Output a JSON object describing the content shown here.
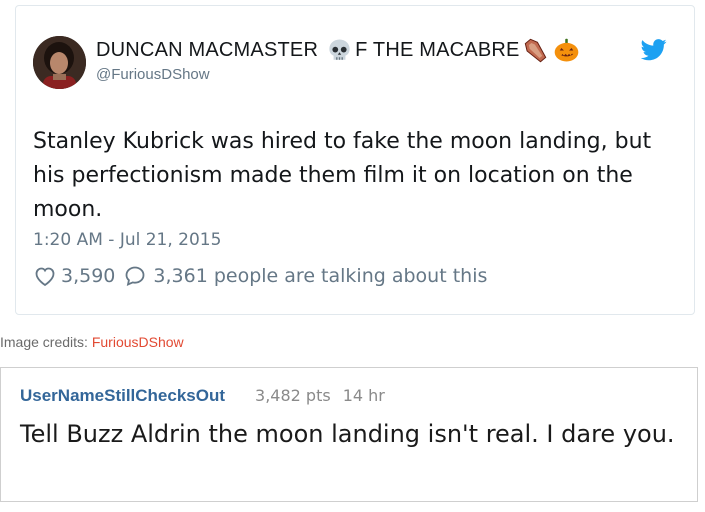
{
  "tweet": {
    "display_name_part1": "DUNCAN MACMASTER",
    "display_name_part2": "F THE MACABRE",
    "emojis": [
      "skull-icon",
      "coffin-icon",
      "pumpkin-icon"
    ],
    "handle": "@FuriousDShow",
    "text": "Stanley Kubrick was hired to fake the moon landing, but his perfectionism made them film it on location on the moon.",
    "timestamp": "1:20 AM - Jul 21, 2015",
    "likes": "3,590",
    "talking": "3,361 people are talking about this",
    "colors": {
      "twitter_blue": "#1da1f2",
      "meta_gray": "#657786"
    }
  },
  "credits": {
    "label": "Image credits:",
    "source": "FuriousDShow"
  },
  "comment": {
    "user": "UserNameStillChecksOut",
    "points": "3,482 pts",
    "time": "14 hr",
    "text": "Tell Buzz Aldrin the moon landing isn't real. I dare you."
  }
}
